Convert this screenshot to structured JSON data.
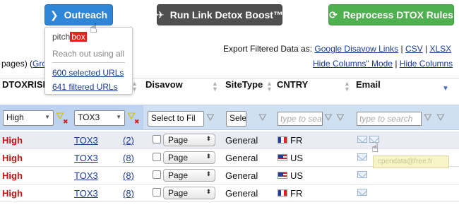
{
  "toolbar": {
    "outreach_label": "Outreach",
    "detox_label": "Run Link Detox Boost™",
    "reprocess_label": "Reprocess DTOX Rules"
  },
  "outreach_menu": {
    "brand_part1": "pitch",
    "brand_part2": "box",
    "reach_text": "Reach out using all",
    "selected_link": "600 selected URLs",
    "filtered_link": "641 filtered URLs"
  },
  "export": {
    "prefix": "Export Filtered Data as:",
    "disavow": "Google Disavow Links",
    "sep1": "|",
    "csv": "CSV",
    "sep2": "|",
    "xlsx": "XLSX",
    "hide_mode": "Hide Columns\" Mode",
    "sep3": "|",
    "hide_cols": "Hide Columns"
  },
  "pages_text": "pages) (",
  "pages_link": "Gro",
  "columns": {
    "dtoxrisk": "DTOXRISK",
    "disavow": "Disavow",
    "sitetype": "SiteType",
    "cntry": "CNTRY",
    "email": "Email"
  },
  "filters": {
    "risk": "High",
    "rule": "TOX3",
    "disavow": "Select to Fil",
    "sitetype": "Sele",
    "cntry_placeholder": "type to sea",
    "email_placeholder": "type to search"
  },
  "rows": [
    {
      "risk": "High",
      "rule": "TOX3",
      "count": "(2)",
      "page": "Page",
      "sitetype": "General",
      "country": "FR"
    },
    {
      "risk": "High",
      "rule": "TOX3",
      "count": "(8)",
      "page": "Page",
      "sitetype": "General",
      "country": "US"
    },
    {
      "risk": "High",
      "rule": "TOX3",
      "count": "(8)",
      "page": "Page",
      "sitetype": "General",
      "country": "US"
    },
    {
      "risk": "High",
      "rule": "TOX3",
      "count": "(8)",
      "page": "Page",
      "sitetype": "General",
      "country": "FR"
    }
  ],
  "tooltip": "cpendata@free.fr"
}
